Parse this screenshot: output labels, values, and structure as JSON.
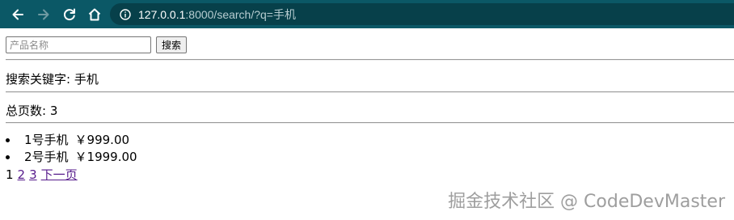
{
  "browser": {
    "url_host": "127.0.0.1",
    "url_path": ":8000/search/?q=手机"
  },
  "search": {
    "placeholder": "产品名称",
    "value": "",
    "button_label": "搜索"
  },
  "keyword_line": "搜索关键字: 手机",
  "total_pages_line": "总页数: 3",
  "results": [
    {
      "name": "1号手机",
      "price": "￥999.00"
    },
    {
      "name": "2号手机",
      "price": "￥1999.00"
    }
  ],
  "pagination": {
    "current": "1",
    "page2": "2",
    "page3": "3",
    "next": "下一页"
  },
  "watermark": "掘金技术社区 @ CodeDevMaster",
  "colors": {
    "toolbar": "#0b5866",
    "address_bar": "#07404a",
    "visited_link": "#551a8b"
  }
}
